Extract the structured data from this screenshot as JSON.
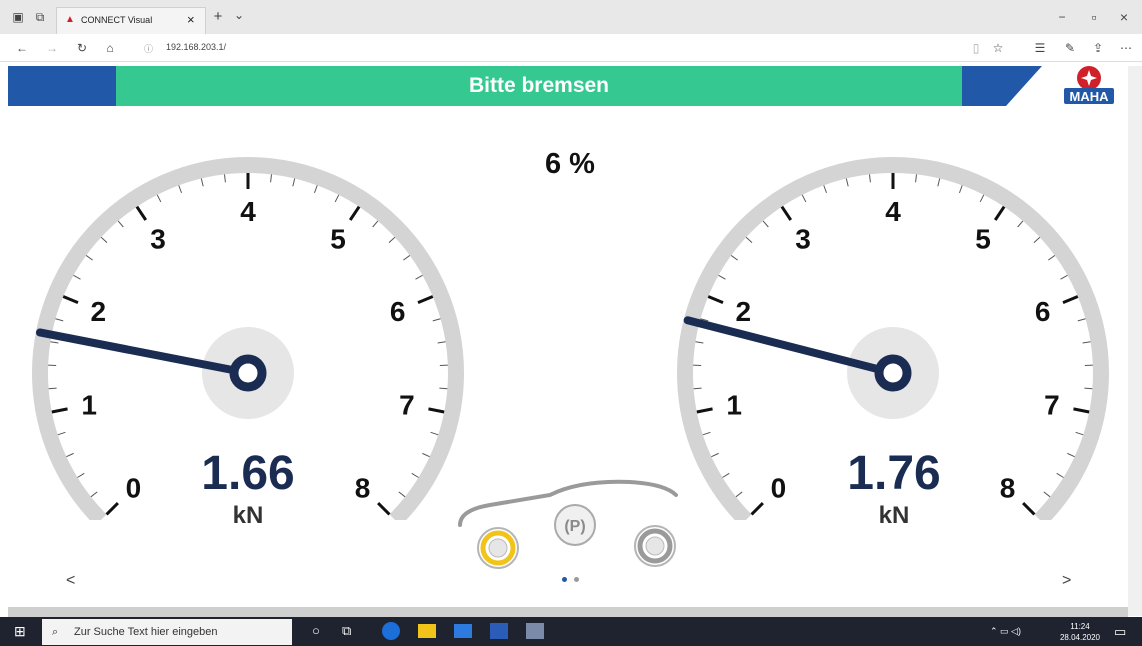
{
  "browser": {
    "tab_title": "CONNECT Visual",
    "tab_close": "×",
    "new_tab": "+",
    "tab_menu": "⌄",
    "url": "192.168.203.1/",
    "win_min": "−",
    "win_max": "▫",
    "win_close": "×"
  },
  "app": {
    "banner": "Bitte bremsen",
    "logo_text": "MAHA",
    "percent": "6 %"
  },
  "gauges": [
    {
      "value": 1.66,
      "value_text": "1.66",
      "unit": "kN",
      "ticks": [
        "0",
        "1",
        "2",
        "3",
        "4",
        "5",
        "6",
        "7",
        "8"
      ],
      "min": 0,
      "max": 8
    },
    {
      "value": 1.76,
      "value_text": "1.76",
      "unit": "kN",
      "ticks": [
        "0",
        "1",
        "2",
        "3",
        "4",
        "5",
        "6",
        "7",
        "8"
      ],
      "min": 0,
      "max": 8
    }
  ],
  "vehicle": {
    "parking_brake_label": "(P)",
    "front_wheel_color": "#f2c318",
    "rear_wheel_color": "#9a9a9a"
  },
  "nav": {
    "prev": "<",
    "next": ">",
    "page_count": 2,
    "active_page": 1
  },
  "taskbar": {
    "search_placeholder": "Zur Suche Text hier eingeben",
    "time": "11:24",
    "date": "28.04.2020"
  },
  "colors": {
    "banner_green": "#35c991",
    "brand_blue": "#2258a8",
    "needle": "#1b2c52",
    "dial": "#d4d4d4"
  }
}
